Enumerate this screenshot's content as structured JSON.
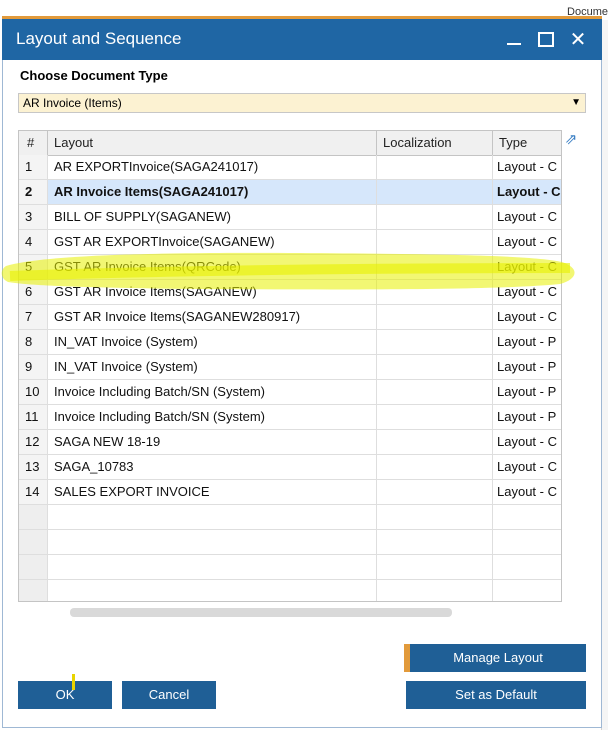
{
  "background": {
    "tab_fragment": "Docume"
  },
  "dialog": {
    "title": "Layout and Sequence",
    "colors": {
      "titlebar": "#1f66a4",
      "accent": "#e29a3b",
      "selection": "#d6e7fb",
      "highlighter": "#e8f000"
    }
  },
  "document_type": {
    "label": "Choose Document Type",
    "selected": "AR Invoice (Items)"
  },
  "grid": {
    "columns": [
      "#",
      "Layout",
      "Localization",
      "Type"
    ],
    "rows": [
      {
        "num": "1",
        "layout": "AR EXPORTInvoice(SAGA241017)",
        "localization": "",
        "type": "Layout - C"
      },
      {
        "num": "2",
        "layout": "AR Invoice Items(SAGA241017)",
        "localization": "",
        "type": "Layout - C",
        "selected": true
      },
      {
        "num": "3",
        "layout": "BILL OF SUPPLY(SAGANEW)",
        "localization": "",
        "type": "Layout - C"
      },
      {
        "num": "4",
        "layout": "GST AR EXPORTInvoice(SAGANEW)",
        "localization": "",
        "type": "Layout - C"
      },
      {
        "num": "5",
        "layout": "GST AR Invoice Items(QRCode)",
        "localization": "",
        "type": "Layout - C"
      },
      {
        "num": "6",
        "layout": "GST AR Invoice Items(SAGANEW)",
        "localization": "",
        "type": "Layout - C"
      },
      {
        "num": "7",
        "layout": "GST AR Invoice Items(SAGANEW280917)",
        "localization": "",
        "type": "Layout - C"
      },
      {
        "num": "8",
        "layout": "IN_VAT Invoice (System)",
        "localization": "",
        "type": "Layout - P"
      },
      {
        "num": "9",
        "layout": "IN_VAT Invoice (System)",
        "localization": "",
        "type": "Layout - P"
      },
      {
        "num": "10",
        "layout": "Invoice Including Batch/SN (System)",
        "localization": "",
        "type": "Layout - P"
      },
      {
        "num": "11",
        "layout": "Invoice Including Batch/SN (System)",
        "localization": "",
        "type": "Layout - P"
      },
      {
        "num": "12",
        "layout": "SAGA NEW 18-19",
        "localization": "",
        "type": "Layout - C"
      },
      {
        "num": "13",
        "layout": "SAGA_10783",
        "localization": "",
        "type": "Layout - C"
      },
      {
        "num": "14",
        "layout": "SALES EXPORT INVOICE",
        "localization": "",
        "type": "Layout - C"
      }
    ],
    "empty_rows": 4
  },
  "buttons": {
    "manage_layout": "Manage Layout",
    "ok": "OK",
    "cancel": "Cancel",
    "set_default": "Set as Default"
  }
}
